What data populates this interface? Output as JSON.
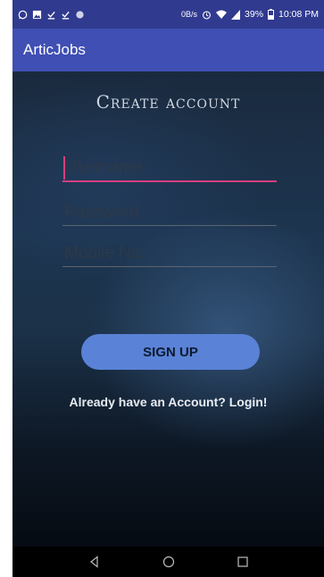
{
  "status_bar": {
    "net_speed": "0B/s",
    "battery": "39%",
    "time": "10:08 PM",
    "icons": [
      "whatsapp-icon",
      "image-icon",
      "download-done-icon",
      "download-done-icon",
      "circle-icon",
      "alarm-icon",
      "wifi-icon",
      "signal-icon",
      "battery-icon"
    ]
  },
  "app_bar": {
    "title": "ArticJobs"
  },
  "form": {
    "heading": "Create account",
    "username_placeholder": "Username",
    "password_placeholder": "Password",
    "mobile_placeholder": "Mobile No.",
    "signup_label": "SIGN UP",
    "login_link": "Already have an Account? Login!"
  },
  "nav_bar": {
    "icons": [
      "back-icon",
      "home-icon",
      "recents-icon"
    ]
  },
  "colors": {
    "status_bar": "#303a8f",
    "app_bar": "#3f4fb3",
    "accent": "#d63f7e",
    "button": "#5a82d6"
  }
}
